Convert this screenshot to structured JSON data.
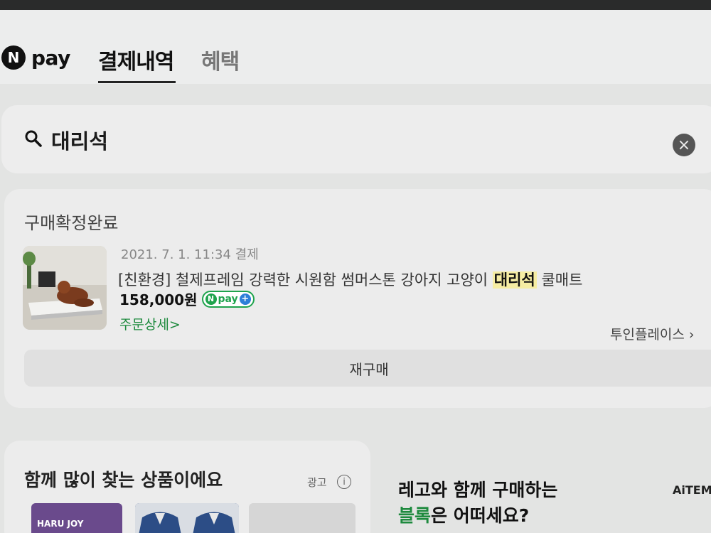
{
  "header": {
    "logo_mark": "N",
    "logo_text": "pay",
    "tabs": [
      {
        "label": "결제내역",
        "active": true
      },
      {
        "label": "혜택",
        "active": false
      }
    ]
  },
  "search": {
    "value": "대리석",
    "icon": "search-icon",
    "clear_icon": "close-icon",
    "clear_glyph": "×"
  },
  "order": {
    "status": "구매확정완료",
    "date": "2021. 7. 1. 11:34 결제",
    "name_before": "[친환경] 철제프레임 강력한 시원함 썸머스톤 강아지 고양이 ",
    "name_highlight": "대리석",
    "name_after": " 쿨매트",
    "price": "158,000원",
    "badge": {
      "mark": "N",
      "text": "pay",
      "plus": "+"
    },
    "detail_link": "주문상세",
    "detail_arrow": ">",
    "seller": "투인플레이스 ›",
    "rebuy_label": "재구매"
  },
  "recommend": {
    "title": "함께 많이 찾는 상품이에요",
    "ad_label": "광고",
    "info_glyph": "i",
    "thumb1_text": "HARU JOY"
  },
  "promo": {
    "line1": "레고와 함께 구매하는",
    "line2_green": "블록",
    "line2_rest": "은 어떠세요?",
    "brand": "AiTEM"
  },
  "colors": {
    "accent_green": "#1e8a3e",
    "highlight": "#f6eda3",
    "npay_blue": "#2d7fd8"
  }
}
